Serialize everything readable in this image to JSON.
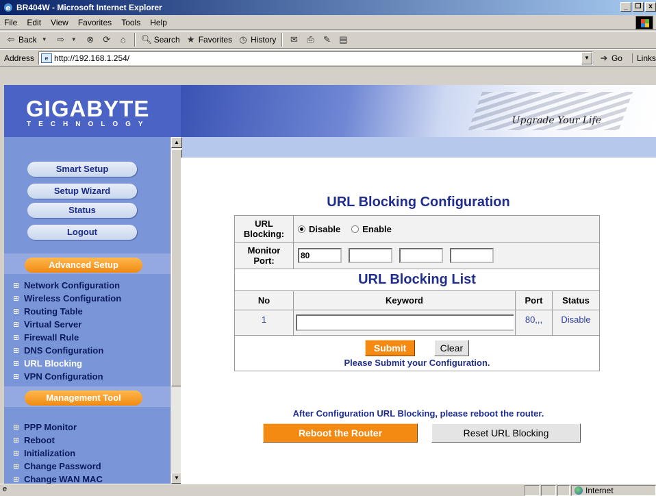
{
  "window": {
    "title": "BR404W - Microsoft Internet Explorer",
    "controls": [
      "_",
      "❐",
      "x"
    ]
  },
  "menu": [
    "File",
    "Edit",
    "View",
    "Favorites",
    "Tools",
    "Help"
  ],
  "toolbar": {
    "back": "Back",
    "search": "Search",
    "favorites": "Favorites",
    "history": "History"
  },
  "address": {
    "label": "Address",
    "url": "http://192.168.1.254/",
    "go": "Go",
    "links": "Links"
  },
  "banner": {
    "logo": "GIGABYTE",
    "logo_sub": "TECHNOLOGY",
    "slogan": "Upgrade Your Life"
  },
  "sidebar": {
    "buttons": [
      "Smart Setup",
      "Setup Wizard",
      "Status",
      "Logout"
    ],
    "advanced_title": "Advanced Setup",
    "advanced_items": [
      "Network Configuration",
      "Wireless Configuration",
      "Routing Table",
      "Virtual Server",
      "Firewall Rule",
      "DNS Configuration",
      "URL Blocking",
      "VPN Configuration"
    ],
    "management_title": "Management Tool",
    "management_items": [
      "PPP Monitor",
      "Reboot",
      "Initialization",
      "Change Password",
      "Change WAN MAC"
    ]
  },
  "main": {
    "title": "URL Blocking Configuration",
    "url_blocking_label": "URL Blocking:",
    "disable_label": "Disable",
    "enable_label": "Enable",
    "monitor_port_label": "Monitor Port:",
    "ports": [
      "80",
      "",
      "",
      ""
    ],
    "list_title": "URL Blocking List",
    "columns": {
      "no": "No",
      "keyword": "Keyword",
      "port": "Port",
      "status": "Status"
    },
    "row": {
      "no": "1",
      "keyword": "",
      "port": "80,,,",
      "status": "Disable"
    },
    "submit": "Submit",
    "clear": "Clear",
    "submit_note": "Please Submit your Configuration.",
    "after_note": "After Configuration URL Blocking, please reboot the router.",
    "reboot": "Reboot the Router",
    "reset": "Reset URL Blocking"
  },
  "status_bar": {
    "zone": "Internet"
  }
}
